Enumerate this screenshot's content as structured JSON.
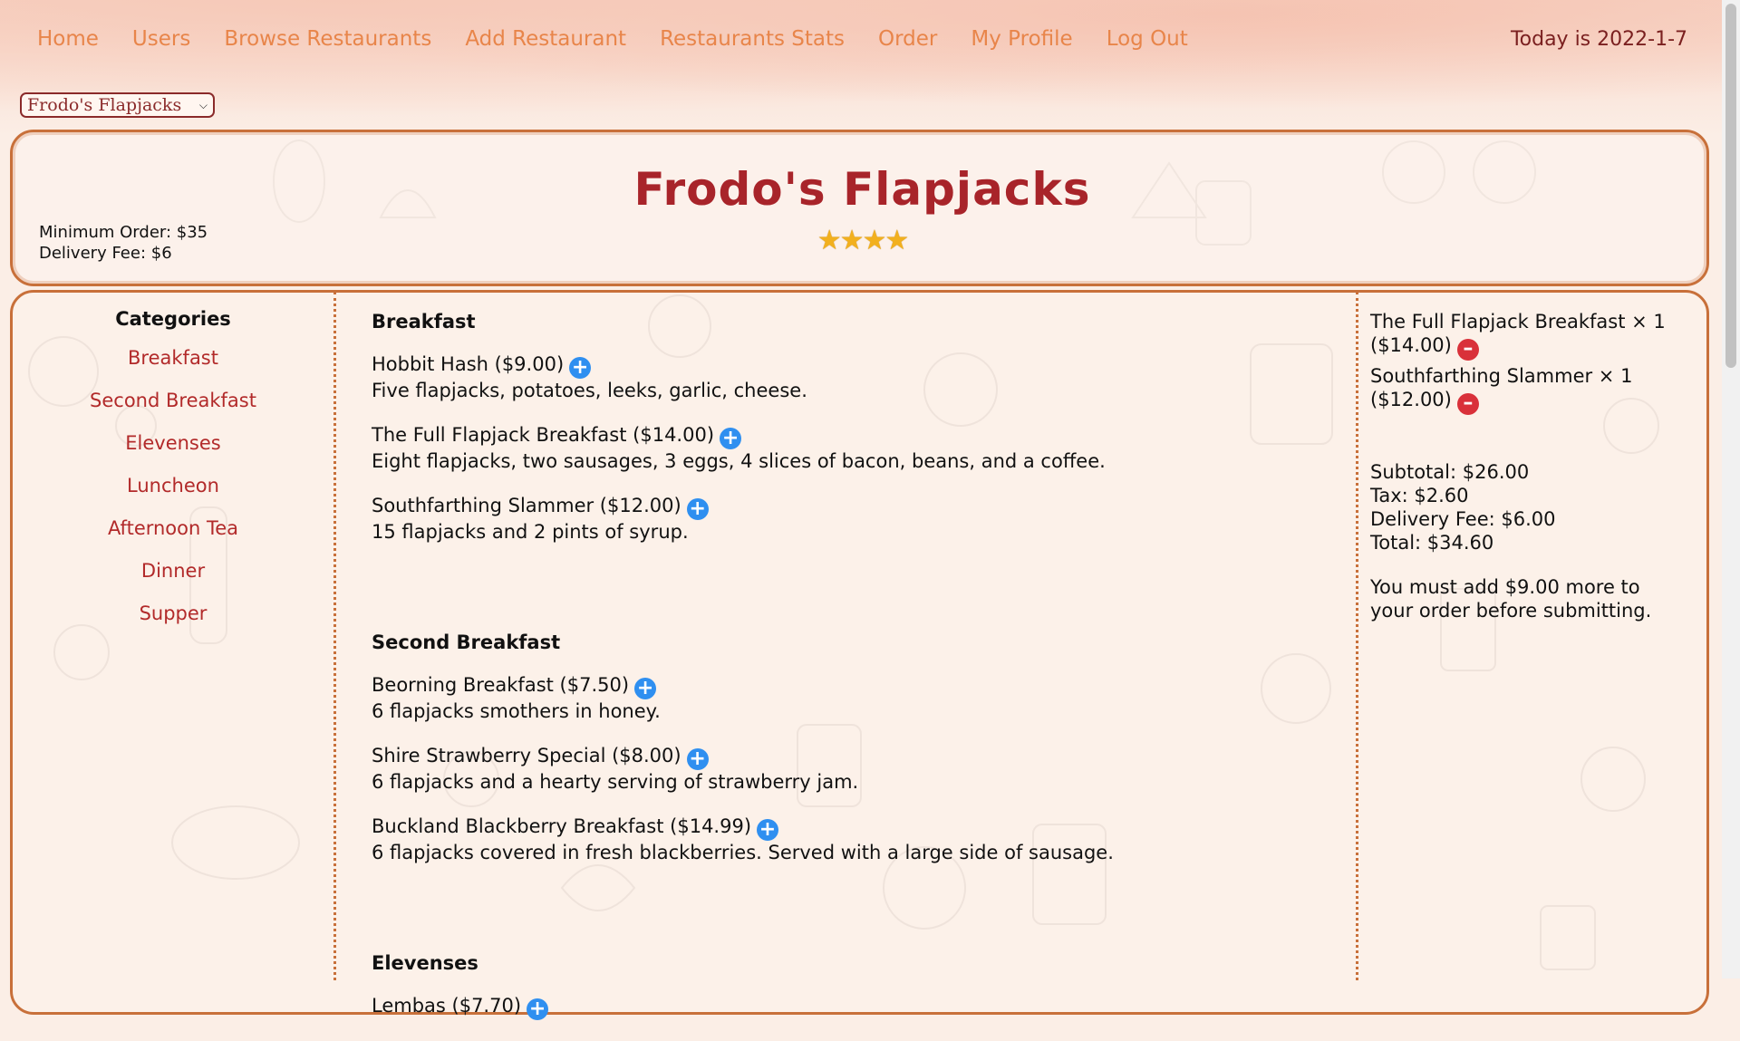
{
  "nav": {
    "items": [
      "Home",
      "Users",
      "Browse Restaurants",
      "Add Restaurant",
      "Restaurants Stats",
      "Order",
      "My Profile",
      "Log Out"
    ]
  },
  "today": "Today is 2022-1-7",
  "restaurant_select": {
    "selected": "Frodo's Flapjacks"
  },
  "restaurant": {
    "name": "Frodo's Flapjacks",
    "rating_stars": 4,
    "stars_text": "★★★★",
    "minimum_order": "Minimum Order: $35",
    "delivery_fee": "Delivery Fee: $6"
  },
  "categories": {
    "title": "Categories",
    "items": [
      "Breakfast",
      "Second Breakfast",
      "Elevenses",
      "Luncheon",
      "Afternoon Tea",
      "Dinner",
      "Supper"
    ]
  },
  "menu": {
    "sections": [
      {
        "title": "Breakfast",
        "items": [
          {
            "name": "Hobbit Hash ($9.00)",
            "desc": "Five flapjacks, potatoes, leeks, garlic, cheese."
          },
          {
            "name": "The Full Flapjack Breakfast ($14.00)",
            "desc": "Eight flapjacks, two sausages, 3 eggs, 4 slices of bacon, beans, and a coffee."
          },
          {
            "name": "Southfarthing Slammer ($12.00)",
            "desc": "15 flapjacks and 2 pints of syrup."
          }
        ]
      },
      {
        "title": "Second Breakfast",
        "items": [
          {
            "name": "Beorning Breakfast ($7.50)",
            "desc": "6 flapjacks smothers in honey."
          },
          {
            "name": "Shire Strawberry Special ($8.00)",
            "desc": "6 flapjacks and a hearty serving of strawberry jam."
          },
          {
            "name": "Buckland Blackberry Breakfast ($14.99)",
            "desc": "6 flapjacks covered in fresh blackberries. Served with a large side of sausage."
          }
        ]
      },
      {
        "title": "Elevenses",
        "items": [
          {
            "name": "Lembas ($7.70)",
            "desc": ""
          }
        ]
      }
    ]
  },
  "cart": {
    "items": [
      {
        "line1": "The Full Flapjack Breakfast × 1",
        "price": "($14.00)"
      },
      {
        "line1": "Southfarthing Slammer × 1",
        "price": "($12.00)"
      }
    ],
    "subtotal": "Subtotal: $26.00",
    "tax": "Tax: $2.60",
    "delivery_fee": "Delivery Fee: $6.00",
    "total": "Total: $34.60",
    "warning": "You must add $9.00 more to your order before submitting."
  },
  "colors": {
    "nav_link": "#e8854a",
    "title": "#a8242a",
    "category_link": "#b22a2a",
    "border": "#c8703a",
    "add_button": "#2f8ff0",
    "remove_button": "#d9313a"
  }
}
